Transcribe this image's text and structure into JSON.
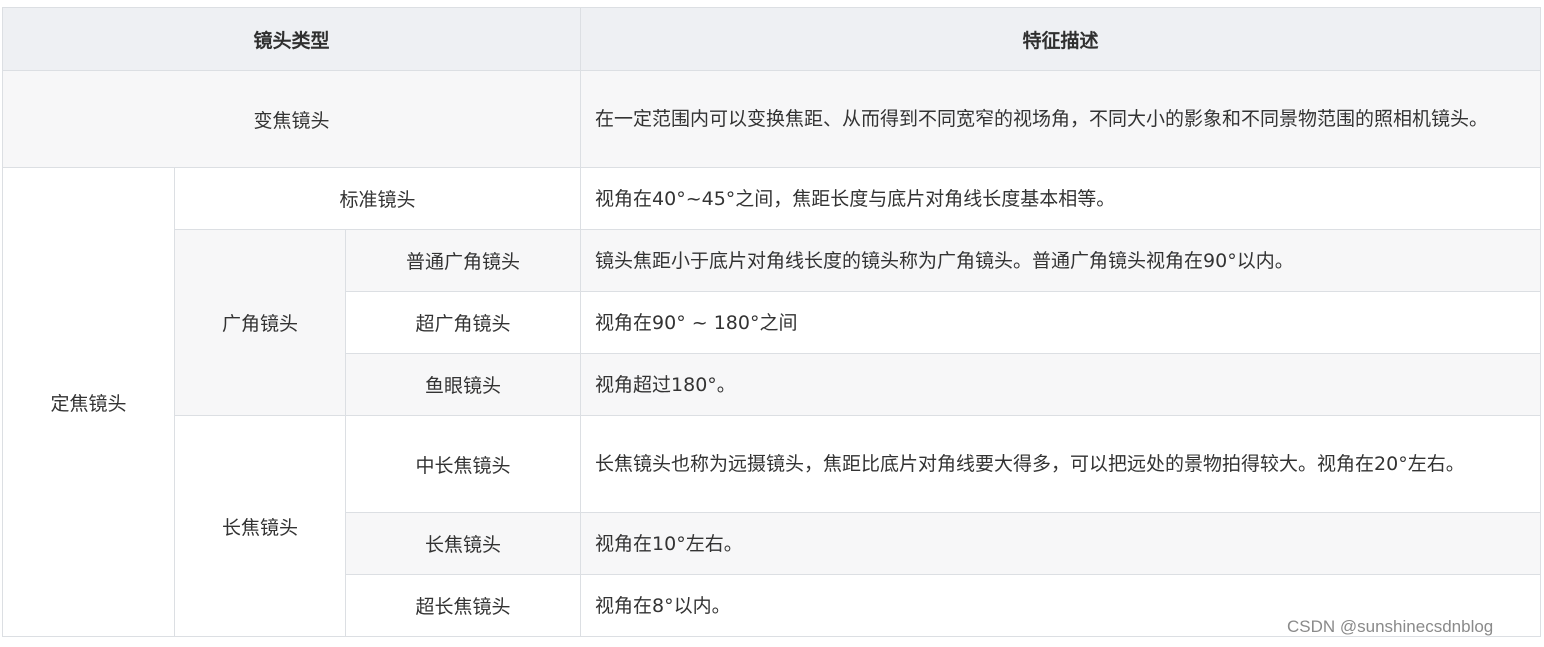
{
  "header": {
    "lens_type": "镜头类型",
    "feature_desc": "特征描述"
  },
  "rows": {
    "zoom": {
      "type": "变焦镜头",
      "desc": "在一定范围内可以变换焦距、从而得到不同宽窄的视场角，不同大小的影象和不同景物范围的照相机镜头。"
    },
    "fixed_focus": "定焦镜头",
    "standard": {
      "type": "标准镜头",
      "desc": "视角在40°~45°之间，焦距长度与底片对角线长度基本相等。"
    },
    "wide_angle": "广角镜头",
    "normal_wide": {
      "type": "普通广角镜头",
      "desc": "镜头焦距小于底片对角线长度的镜头称为广角镜头。普通广角镜头视角在90°以内。"
    },
    "ultra_wide": {
      "type": "超广角镜头",
      "desc": "视角在90° ~ 180°之间"
    },
    "fisheye": {
      "type": "鱼眼镜头",
      "desc": "视角超过180°。"
    },
    "telephoto": "长焦镜头",
    "mid_tele": {
      "type": "中长焦镜头",
      "desc": "长焦镜头也称为远摄镜头，焦距比底片对角线要大得多，可以把远处的景物拍得较大。视角在20°左右。"
    },
    "tele": {
      "type": "长焦镜头",
      "desc": "视角在10°左右。"
    },
    "super_tele": {
      "type": "超长焦镜头",
      "desc": "视角在8°以内。"
    }
  },
  "watermark": "CSDN @sunshinecsdnblog",
  "colors": {
    "header_bg": "#eef0f3",
    "shaded_row_bg": "#f7f7f8",
    "border": "#dcdfe3",
    "text": "#333333"
  }
}
